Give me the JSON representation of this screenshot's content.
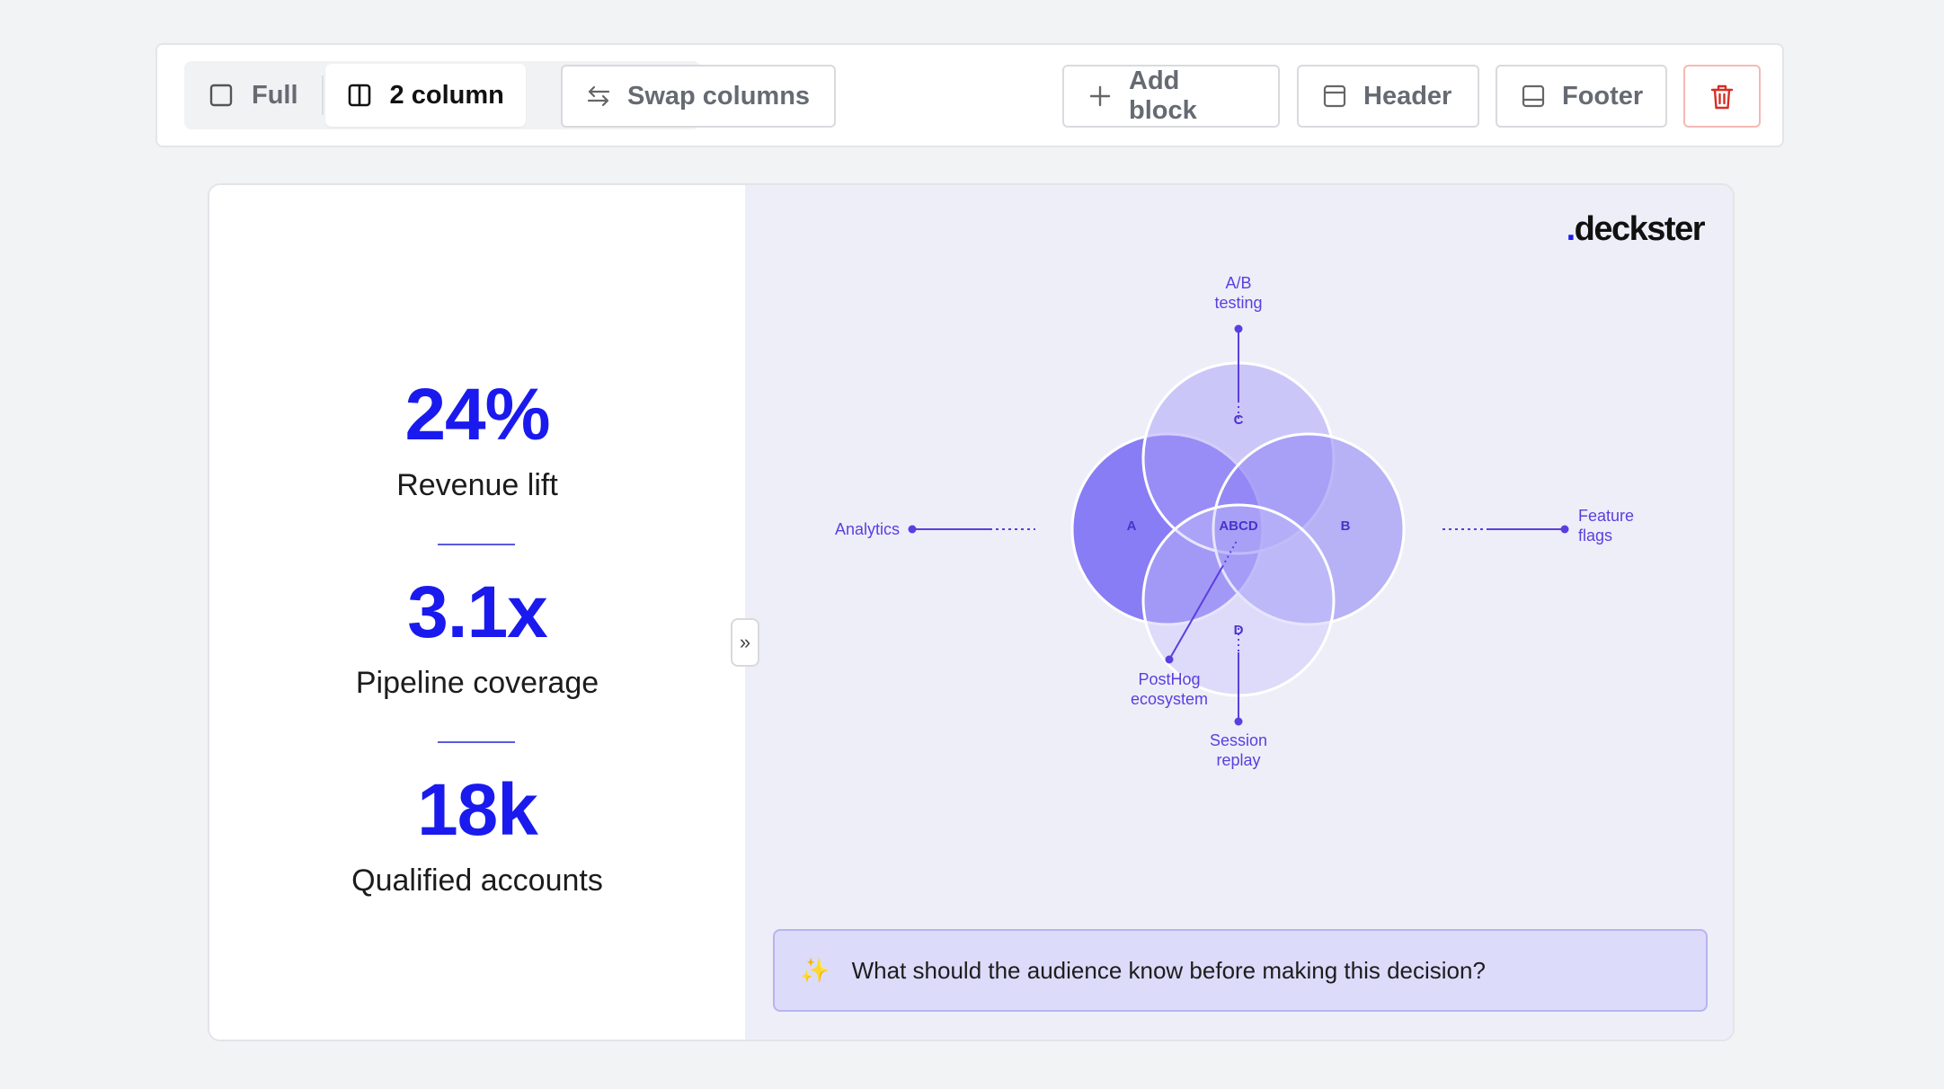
{
  "toolbar": {
    "layout_full": "Full",
    "layout_two_column": "2 column",
    "swap_columns": "Swap columns",
    "add_block": "Add block",
    "header": "Header",
    "footer": "Footer"
  },
  "slide": {
    "brand": "deckster",
    "stats": [
      {
        "value": "24%",
        "label": "Revenue lift"
      },
      {
        "value": "3.1x",
        "label": "Pipeline coverage"
      },
      {
        "value": "18k",
        "label": "Qualified accounts"
      }
    ],
    "collapse_glyph": "»",
    "venn": {
      "sets": [
        {
          "id": "A",
          "label": "A",
          "callout": [
            "Analytics"
          ]
        },
        {
          "id": "B",
          "label": "B",
          "callout": [
            "Feature",
            "flags"
          ]
        },
        {
          "id": "C",
          "label": "C",
          "callout": [
            "A/B",
            "testing"
          ]
        },
        {
          "id": "D",
          "label": "D",
          "callout": [
            "Session",
            "replay"
          ]
        }
      ],
      "intersection": {
        "label": "ABCD",
        "callout": [
          "PostHog",
          "ecosystem"
        ]
      }
    },
    "prompt": {
      "icon": "sparkles-icon",
      "text": "What should the audience know before making this decision?"
    }
  },
  "colors": {
    "accent": "#1a1aee",
    "venn_stroke": "#5b3ee0",
    "delete": "#d62e26"
  }
}
